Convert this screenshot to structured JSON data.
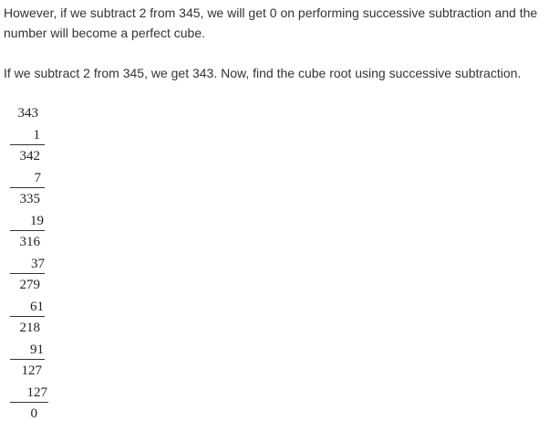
{
  "paragraphs": [
    "However, if we subtract 2 from 345, we will get 0 on performing successive subtraction and the number will become a perfect cube.",
    "If we subtract 2 from 345, we get 343. Now, find the cube root using successive subtraction."
  ],
  "subtraction_steps": [
    {
      "minuend": "343",
      "subtrahend": "1"
    },
    {
      "minuend": "342",
      "subtrahend": "7"
    },
    {
      "minuend": "335",
      "subtrahend": "19"
    },
    {
      "minuend": "316",
      "subtrahend": "37"
    },
    {
      "minuend": "279",
      "subtrahend": "61"
    },
    {
      "minuend": "218",
      "subtrahend": "91"
    },
    {
      "minuend": "127",
      "subtrahend": "127"
    }
  ],
  "final_result": "0"
}
